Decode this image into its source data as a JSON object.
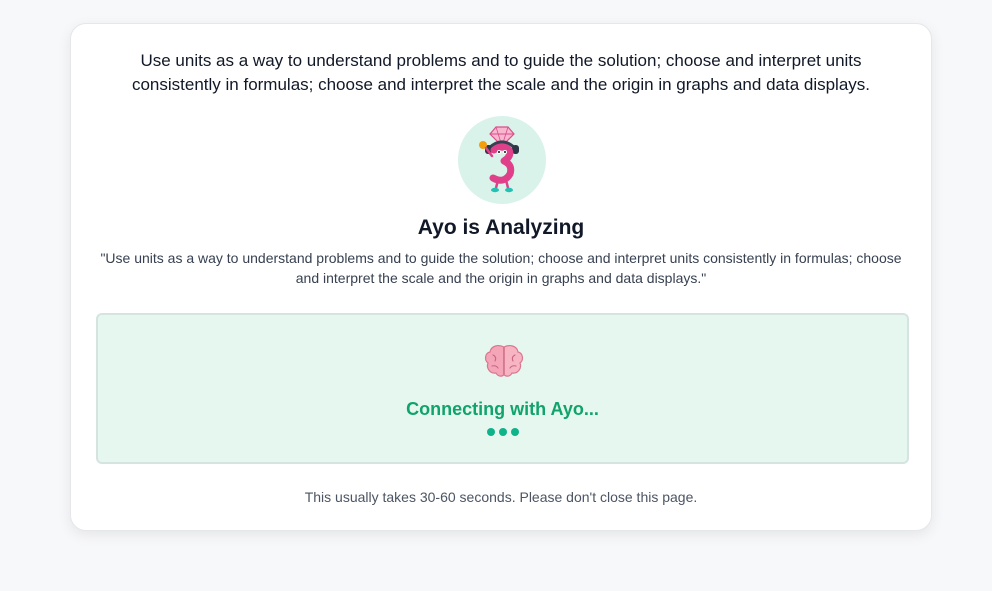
{
  "standard_text": "Use units as a way to understand problems and to guide the solution; choose and interpret units consistently in formulas; choose and interpret the scale and the origin in graphs and data displays.",
  "avatar": {
    "icon": "ayo-mascot-icon"
  },
  "title": "Ayo is Analyzing",
  "quote": "\"Use units as a way to understand problems and to guide the solution; choose and interpret units consistently in formulas; choose and interpret the scale and the origin in graphs and data displays.\"",
  "status": {
    "icon": "brain-icon",
    "text": "Connecting with Ayo...",
    "dots": 3
  },
  "note": "This usually takes 30-60 seconds. Please don't close this page.",
  "colors": {
    "accent": "#10a36b",
    "status_bg": "#e6f7f0",
    "avatar_bg": "#d9f3ea",
    "dots": "#0fb38a"
  }
}
